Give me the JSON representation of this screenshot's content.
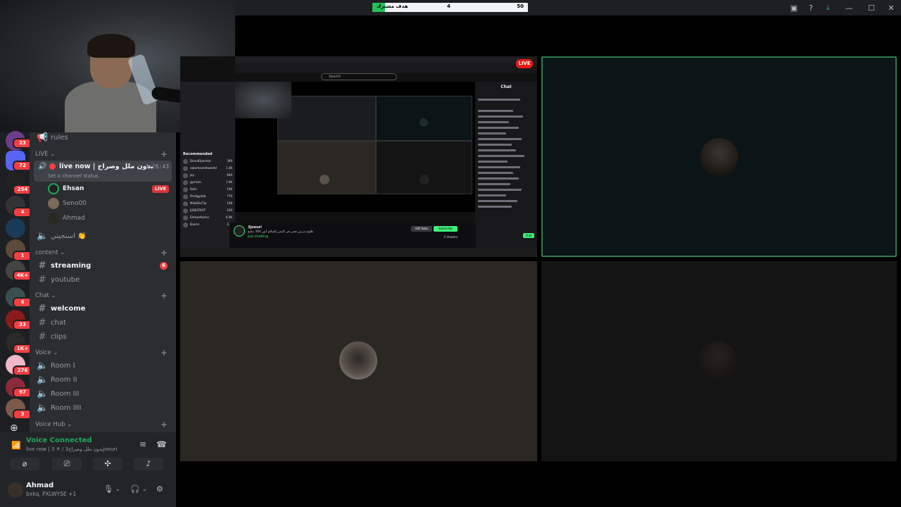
{
  "goal_bar": {
    "label": "هدف مشترك",
    "current": "4",
    "target": "50",
    "progress": 0.08
  },
  "window_controls": [
    "screen-share-icon",
    "help-icon",
    "download-icon",
    "minimize-icon",
    "maximize-icon",
    "close-icon"
  ],
  "server_rail": {
    "badges": [
      "23",
      "72",
      "254",
      "4",
      "1",
      "4K+",
      "6",
      "33",
      "1K+",
      "276",
      "97",
      "3"
    ]
  },
  "sidebar": {
    "top_channel": "rules",
    "live_category": "LIVE",
    "active_channel": {
      "name": "live now | بدون ملل وصراخ",
      "timer": "4:26:43",
      "status_placeholder": "Set a channel status"
    },
    "voice_users": [
      {
        "name": "Ehsan",
        "live": true
      },
      {
        "name": "Seno00",
        "live": false
      },
      {
        "name": "Ahmad",
        "live": false
      }
    ],
    "live_badge": "LIVE",
    "afk_channel": "استجيني 👏",
    "categories": [
      {
        "name": "content",
        "channels": [
          {
            "name": "streaming",
            "unread": true,
            "badge": "6"
          },
          {
            "name": "youtube",
            "unread": false
          }
        ]
      },
      {
        "name": "Chat",
        "channels": [
          {
            "name": "welcome",
            "unread": true
          },
          {
            "name": "chat",
            "unread": false
          },
          {
            "name": "clips",
            "unread": false
          }
        ]
      },
      {
        "name": "Voice",
        "channels": [
          {
            "name": "Room I"
          },
          {
            "name": "Room II"
          },
          {
            "name": "Room III"
          },
          {
            "name": "Room IIII"
          }
        ]
      },
      {
        "name": "Voice Hub",
        "channels": []
      }
    ]
  },
  "voice_panel": {
    "title": "Voice Connected",
    "subtitle": "live now | 3 ⚘ / بدون ملل وصراخ3joouri"
  },
  "user_panel": {
    "name": "Ahmad",
    "status": "bxkq, PXLWYSE +1"
  },
  "shared_screen": {
    "live_badge": "LIVE",
    "search_placeholder": "Search",
    "chat_title": "Chat",
    "recommended_title": "Recommended",
    "recommended": [
      {
        "name": "DonutOperator",
        "viewers": "399"
      },
      {
        "name": "robertoveilinwordd",
        "viewers": "1.4K"
      },
      {
        "name": "Jay",
        "viewers": "640"
      },
      {
        "name": "gymsim",
        "viewers": "1.0K"
      },
      {
        "name": "Kaiie",
        "viewers": "196"
      },
      {
        "name": "Prodigydeb",
        "viewers": "779"
      },
      {
        "name": "MikeDikCity",
        "viewers": "108"
      },
      {
        "name": "JUBEATKVT",
        "viewers": "100"
      },
      {
        "name": "Edmaethome",
        "viewers": "6.9K"
      },
      {
        "name": "Kooms",
        "viewers": "140"
      }
    ],
    "streamer": "3joouri",
    "stream_title": "طلوع مرتين قصر في اليمن إلسلام أنور 300 متابع",
    "category": "Just Chatting",
    "gift_label": "Gift Subs",
    "subscribe_label": "Subscribe",
    "viewers": "5 Viewers",
    "chat_button": "Chat"
  }
}
